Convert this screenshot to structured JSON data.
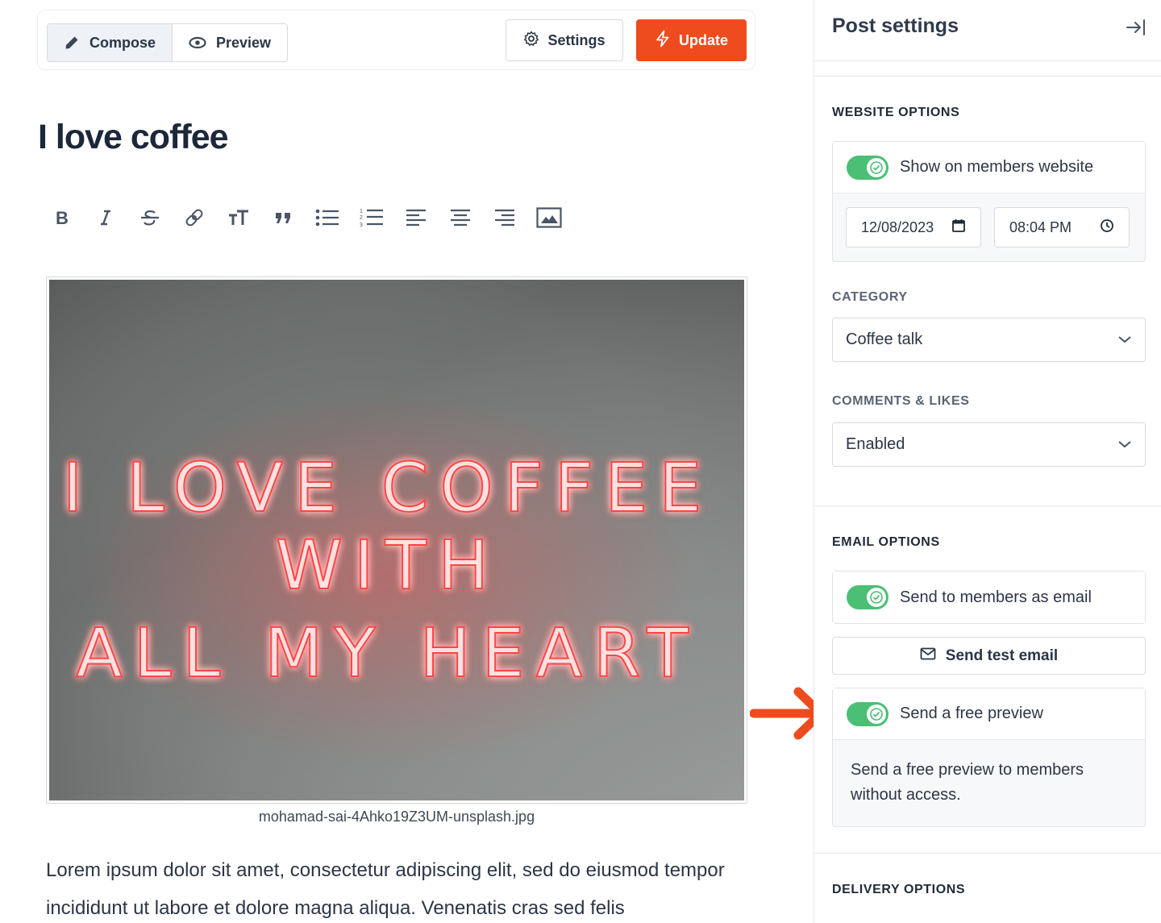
{
  "editor": {
    "tabs": [
      {
        "label": "Compose",
        "icon": "pencil-icon",
        "active": true
      },
      {
        "label": "Preview",
        "icon": "eye-icon",
        "active": false
      }
    ],
    "settings_label": "Settings",
    "update_label": "Update",
    "accent_color": "#ee4b1f",
    "title": "I love coffee",
    "toolbar": [
      "bold-icon",
      "italic-icon",
      "strikethrough-icon",
      "link-icon",
      "heading-icon",
      "quote-icon",
      "bullet-list-icon",
      "numbered-list-icon",
      "align-left-icon",
      "align-center-icon",
      "align-right-icon",
      "image-icon"
    ],
    "image": {
      "description": "Red neon sign on grey wall",
      "neon_lines": [
        "I LOVE COFFEE",
        "WITH",
        "ALL MY HEART"
      ],
      "caption": "mohamad-sai-4Ahko19Z3UM-unsplash.jpg"
    },
    "body": "Lorem ipsum dolor sit amet, consectetur adipiscing elit, sed do eiusmod tempor incididunt ut labore et dolore magna aliqua. Venenatis cras sed felis"
  },
  "sidebar": {
    "title": "Post settings",
    "website_options": {
      "label": "WEBSITE OPTIONS",
      "show_on_website": {
        "label": "Show on members website",
        "on": true
      },
      "date": "12/08/2023",
      "time": "08:04 PM"
    },
    "category": {
      "label": "CATEGORY",
      "value": "Coffee talk"
    },
    "comments": {
      "label": "COMMENTS & LIKES",
      "value": "Enabled"
    },
    "email_options": {
      "label": "EMAIL OPTIONS",
      "send_as_email": {
        "label": "Send to members as email",
        "on": true
      },
      "test_email_label": "Send test email",
      "free_preview": {
        "label": "Send a free preview",
        "on": true
      },
      "free_preview_desc": "Send a free preview to members without access."
    },
    "delivery_options": {
      "label": "DELIVERY OPTIONS"
    },
    "toggle_color": "#4bbf73"
  }
}
